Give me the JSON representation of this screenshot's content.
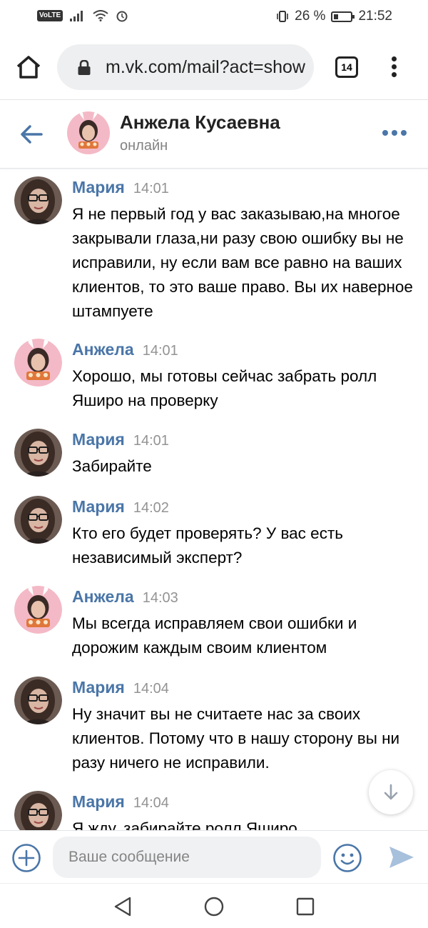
{
  "status_bar": {
    "network_badge": "VoLTE",
    "battery": "26 %",
    "battery_level": 0.26,
    "time": "21:52"
  },
  "browser": {
    "url": "m.vk.com/mail?act=show",
    "tab_count": "14"
  },
  "chat": {
    "contact_name": "Анжела Кусаевна",
    "contact_status": "онлайн"
  },
  "messages": [
    {
      "author": "Мария",
      "time": "14:01",
      "avatar": "maria-avatar",
      "text": "Я не первый год у вас заказываю,на многое закрывали глаза,ни разу свою ошибку вы не исправили, ну если вам все равно на ваших клиентов, то это ваше право. Вы их наверное штампуете"
    },
    {
      "author": "Анжела",
      "time": "14:01",
      "avatar": "angela-avatar",
      "text": "Хорошо, мы готовы сейчас забрать ролл Яширо на проверку"
    },
    {
      "author": "Мария",
      "time": "14:01",
      "avatar": "maria-avatar",
      "text": "Забирайте"
    },
    {
      "author": "Мария",
      "time": "14:02",
      "avatar": "maria-avatar",
      "text": "Кто его будет проверять? У вас есть независимый эксперт?"
    },
    {
      "author": "Анжела",
      "time": "14:03",
      "avatar": "angela-avatar",
      "text": "Мы всегда исправляем свои ошибки и дорожим каждым своим клиентом"
    },
    {
      "author": "Мария",
      "time": "14:04",
      "avatar": "maria-avatar",
      "text": "Ну значит вы не считаете нас за своих клиентов. Потому что в нашу сторону вы ни разу ничего не исправили."
    },
    {
      "author": "Мария",
      "time": "14:04",
      "avatar": "maria-avatar",
      "text": "Я жду, забирайте ролл Яширо"
    }
  ],
  "composer": {
    "placeholder": "Ваше сообщение"
  },
  "colors": {
    "accent": "#4a76a8",
    "send": "#a7c0dc",
    "time": "#939393"
  }
}
